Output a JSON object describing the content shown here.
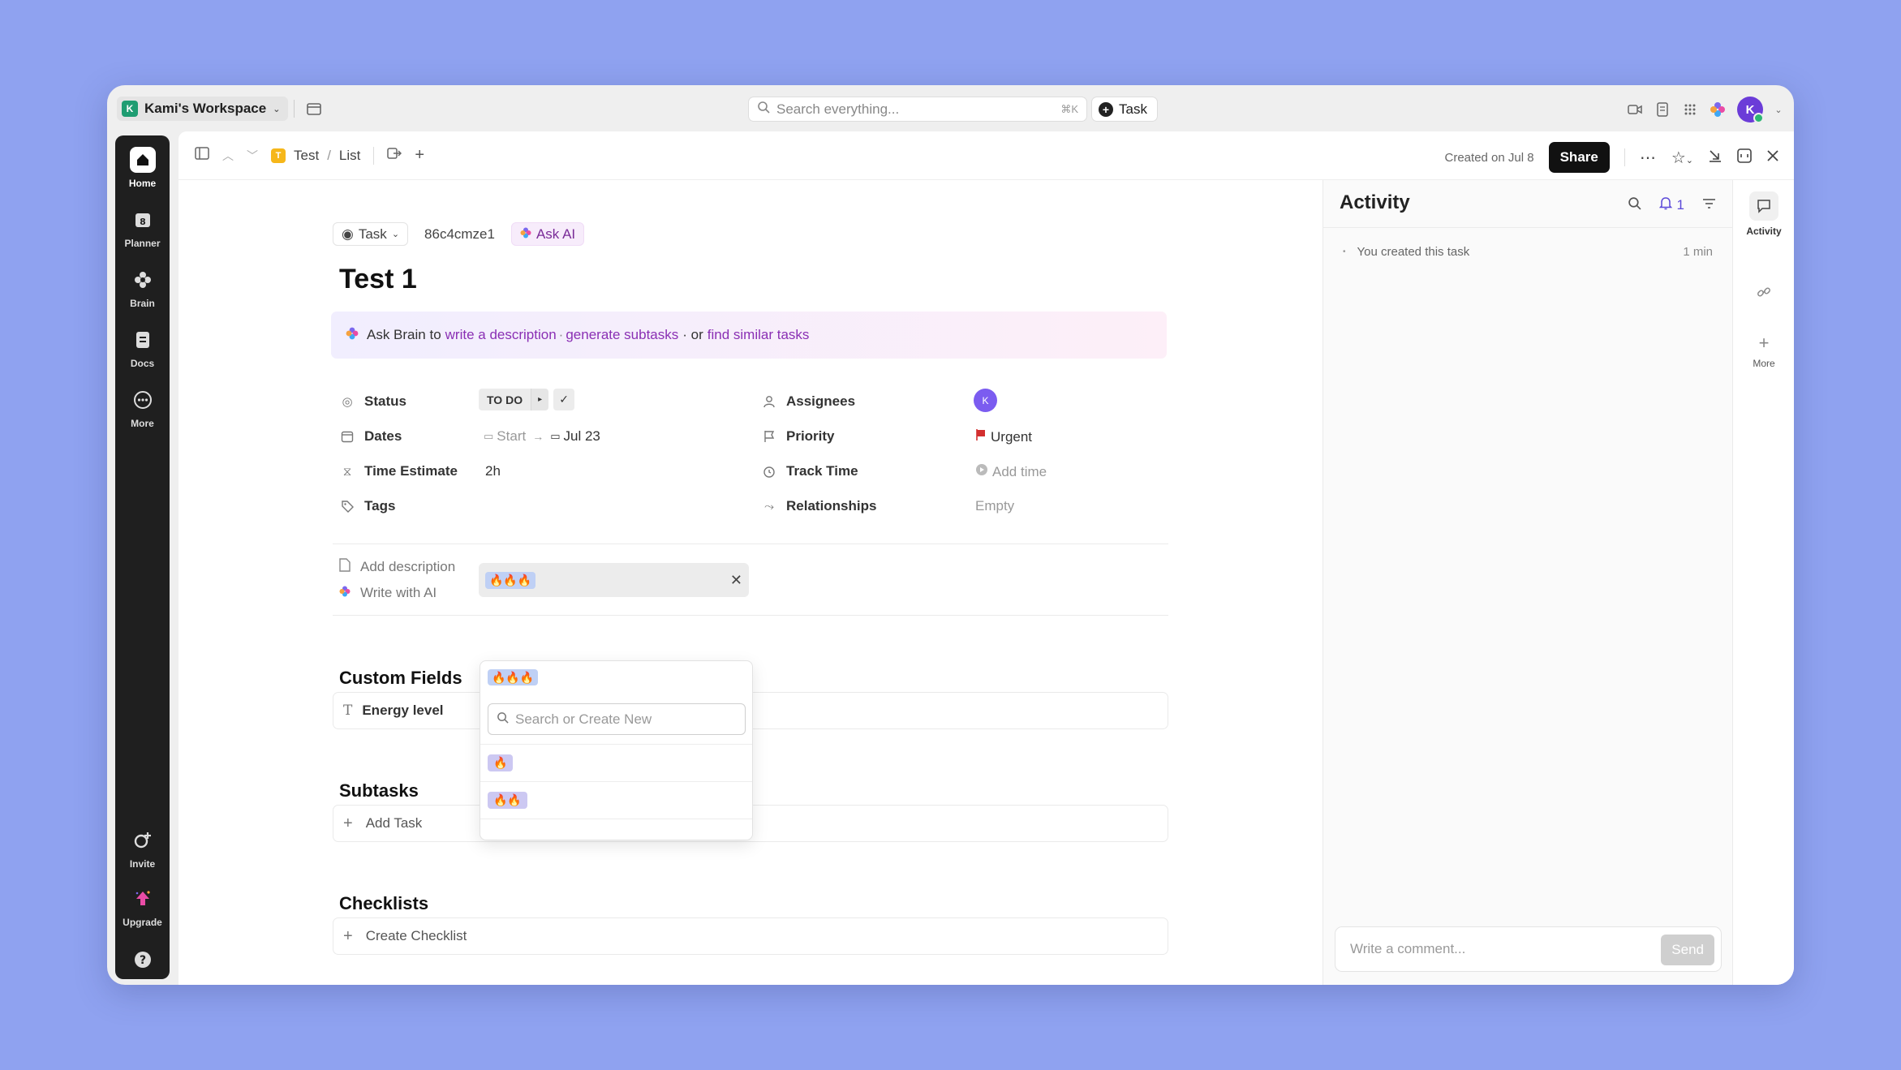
{
  "window": {
    "workspace": {
      "initial": "K",
      "name": "Kami's Workspace"
    },
    "search": {
      "placeholder": "Search everything...",
      "shortcut": "⌘K"
    },
    "new_task_label": "Task",
    "user_initial": "K"
  },
  "sidebar": {
    "items": [
      {
        "label": "Home",
        "icon": "home-icon"
      },
      {
        "label": "Planner",
        "icon": "calendar-icon",
        "badge": "8"
      },
      {
        "label": "Brain",
        "icon": "brain-icon"
      },
      {
        "label": "Docs",
        "icon": "doc-icon"
      },
      {
        "label": "More",
        "icon": "more-icon"
      }
    ],
    "bottom": [
      {
        "label": "Invite",
        "icon": "invite-icon"
      },
      {
        "label": "Upgrade",
        "icon": "upgrade-icon"
      },
      {
        "label": "?",
        "icon": "help-icon"
      }
    ]
  },
  "breadcrumb": {
    "space_initial": "T",
    "space": "Test",
    "sep": "/",
    "list": "List"
  },
  "header": {
    "created": "Created on Jul 8",
    "share": "Share"
  },
  "task": {
    "type": "Task",
    "id": "86c4cmze1",
    "ask_ai": "Ask AI",
    "title": "Test 1",
    "brain": {
      "prefix": "Ask Brain to",
      "link1": "write a description",
      "dot": "·",
      "link2": "generate subtasks",
      "or": "· or",
      "link3": "find similar tasks"
    },
    "fields": {
      "status_label": "Status",
      "status_value": "TO DO",
      "dates_label": "Dates",
      "dates_start": "Start",
      "dates_due": "Jul 23",
      "time_estimate_label": "Time Estimate",
      "time_estimate_value": "2h",
      "tags_label": "Tags",
      "tags_value": "🔥🔥🔥",
      "assignees_label": "Assignees",
      "assignee_initial": "K",
      "priority_label": "Priority",
      "priority_value": "Urgent",
      "track_time_label": "Track Time",
      "track_time_value": "Add time",
      "relationships_label": "Relationships",
      "relationships_value": "Empty"
    },
    "add_description": "Add description",
    "write_with_ai": "Write with AI",
    "custom_fields_title": "Custom Fields",
    "custom_field_energy": "Energy level",
    "subtasks_title": "Subtasks",
    "add_task": "Add Task",
    "checklists_title": "Checklists",
    "create_checklist": "Create Checklist"
  },
  "tags_dropdown": {
    "selected": "🔥🔥🔥",
    "search_placeholder": "Search or Create New",
    "options": [
      "🔥",
      "🔥🔥"
    ]
  },
  "activity": {
    "title": "Activity",
    "notif_count": "1",
    "items": [
      {
        "text": "You created this task",
        "time": "1 min"
      }
    ],
    "comment_placeholder": "Write a comment...",
    "send": "Send"
  },
  "rail": {
    "activity_label": "Activity",
    "more_label": "More"
  },
  "colors": {
    "accent": "#7b68ee",
    "brain_link": "#8a2fb4",
    "urgent": "#d32f2f",
    "background": "#8fa2f0"
  }
}
